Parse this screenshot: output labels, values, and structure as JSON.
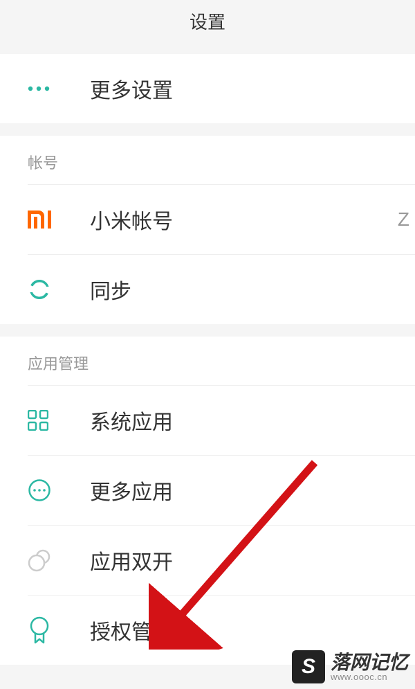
{
  "header": {
    "title": "设置"
  },
  "topSection": {
    "items": [
      {
        "label": "更多设置"
      }
    ]
  },
  "accountSection": {
    "header": "帐号",
    "items": [
      {
        "label": "小米帐号",
        "value": "Z"
      },
      {
        "label": "同步"
      }
    ]
  },
  "appSection": {
    "header": "应用管理",
    "items": [
      {
        "label": "系统应用"
      },
      {
        "label": "更多应用"
      },
      {
        "label": "应用双开"
      },
      {
        "label": "授权管理"
      }
    ]
  },
  "watermark": {
    "main": "落网记忆",
    "sub": "www.oooc.cn"
  },
  "colors": {
    "teal": "#2bb8a3",
    "orange": "#ff6700",
    "grey": "#bbbbbb",
    "red": "#d31216"
  }
}
